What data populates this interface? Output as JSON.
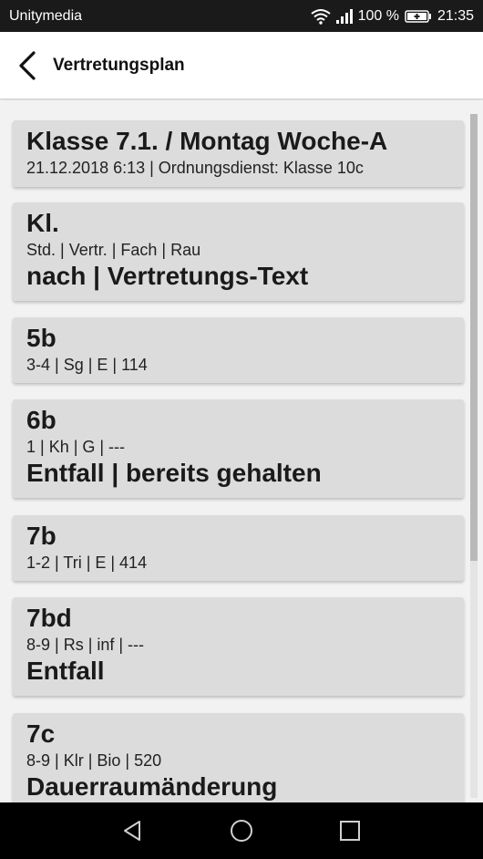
{
  "status_bar": {
    "carrier": "Unitymedia",
    "battery": "100 %",
    "time": "21:35",
    "icons": [
      "wifi-icon",
      "signal-icon",
      "battery-charging-icon"
    ]
  },
  "app_bar": {
    "title": "Vertretungsplan",
    "back_icon": "back-arrow-icon"
  },
  "header_card": {
    "title": "Klasse 7.1. / Montag Woche-A",
    "subtitle": "21.12.2018 6:13 | Ordnungsdienst: Klasse 10c"
  },
  "legend_card": {
    "class_label": "Kl.",
    "columns": "Std. | Vertr. | Fach | Rau",
    "note": "nach | Vertretungs-Text"
  },
  "entries": [
    {
      "class": "5b",
      "details": "3-4 | Sg | E | 114",
      "note": ""
    },
    {
      "class": "6b",
      "details": "1 | Kh | G | ---",
      "note": "Entfall | bereits gehalten"
    },
    {
      "class": "7b",
      "details": "1-2 | Tri | E | 414",
      "note": ""
    },
    {
      "class": "7bd",
      "details": "8-9 | Rs | inf | ---",
      "note": "Entfall"
    },
    {
      "class": "7c",
      "details": "8-9 | Klr | Bio | 520",
      "note": "Dauerraumänderung"
    }
  ],
  "nav_bar": {
    "icons": [
      "back-triangle-icon",
      "home-circle-icon",
      "recents-square-icon"
    ]
  }
}
